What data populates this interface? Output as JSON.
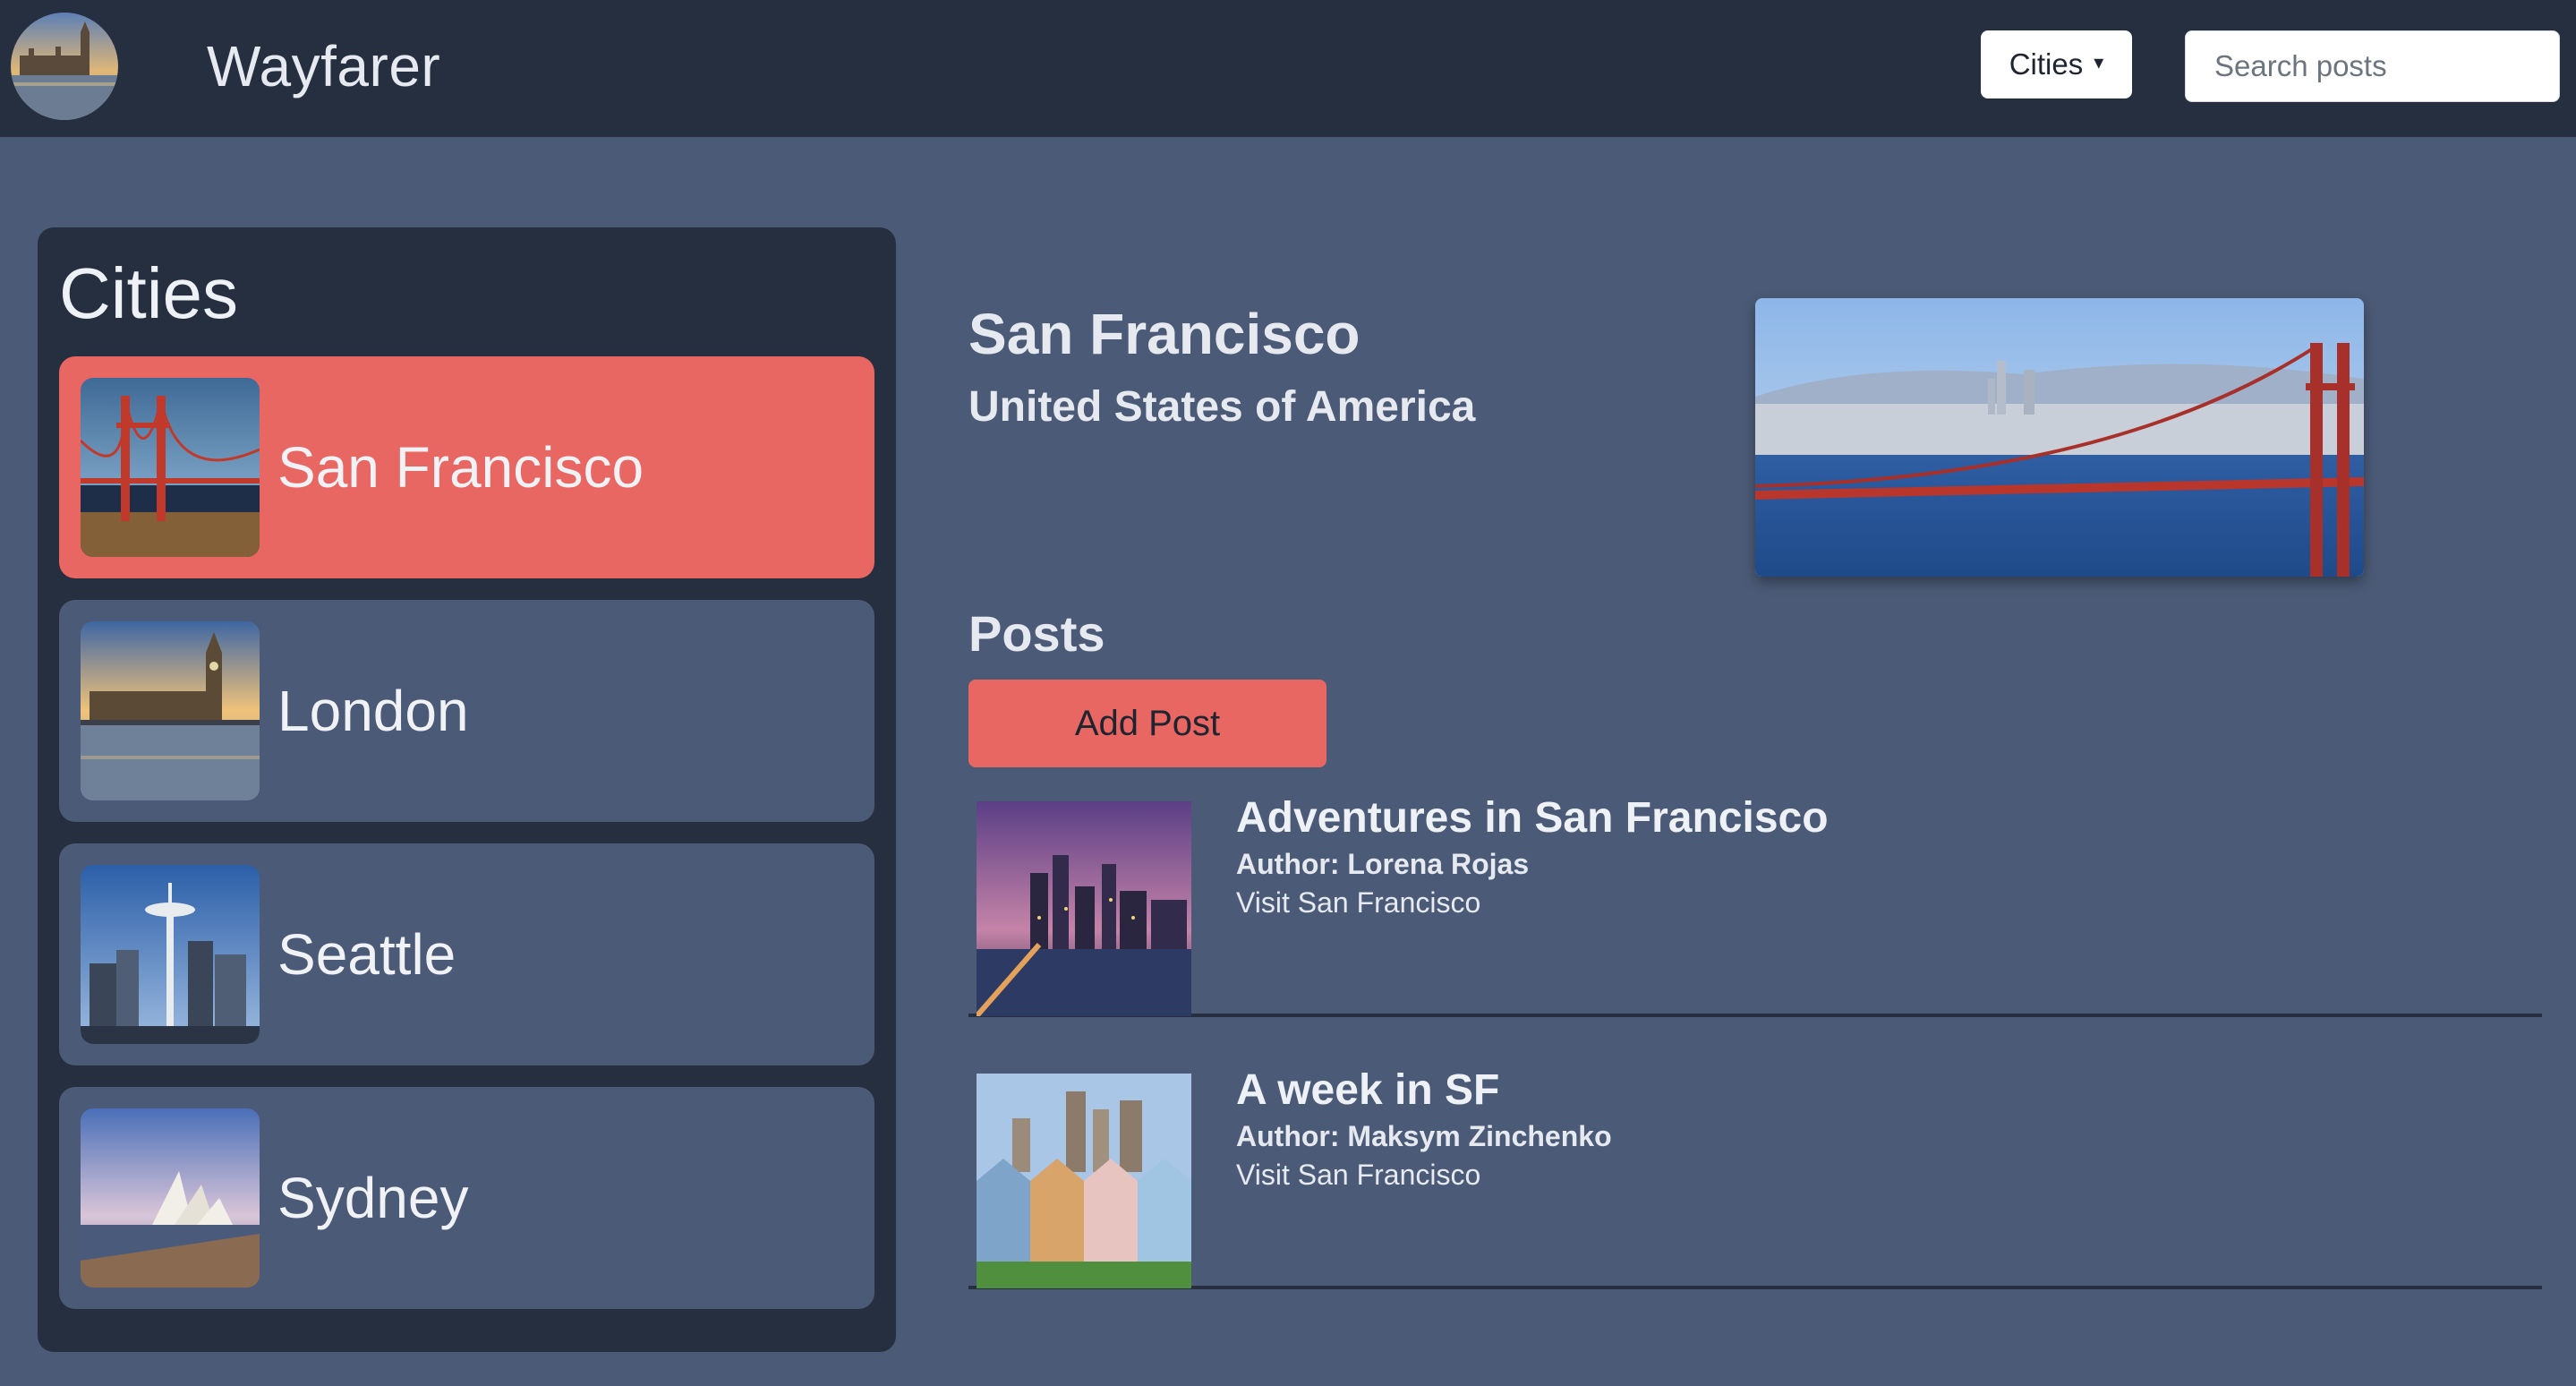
{
  "navbar": {
    "brand": "Wayfarer",
    "cities_dropdown_label": "Cities",
    "search_placeholder": "Search posts"
  },
  "sidebar": {
    "title": "Cities",
    "cities": [
      {
        "name": "San Francisco",
        "active": true
      },
      {
        "name": "London",
        "active": false
      },
      {
        "name": "Seattle",
        "active": false
      },
      {
        "name": "Sydney",
        "active": false
      }
    ]
  },
  "main": {
    "city_name": "San Francisco",
    "country": "United States of America",
    "posts_heading": "Posts",
    "add_post_label": "Add Post",
    "posts": [
      {
        "title": "Adventures in San Francisco",
        "author": "Author: Lorena Rojas",
        "city_link": "Visit San Francisco"
      },
      {
        "title": "A week in SF",
        "author": "Author: Maksym Zinchenko",
        "city_link": "Visit San Francisco"
      }
    ]
  },
  "colors": {
    "navbar_bg": "#262f40",
    "page_bg": "#4b5a76",
    "accent": "#e86762"
  }
}
